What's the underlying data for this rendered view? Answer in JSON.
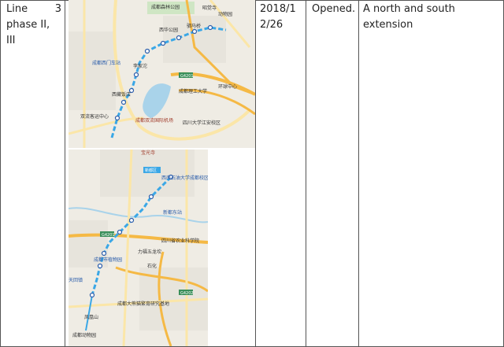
{
  "row": {
    "line_label_a": "Line",
    "line_label_num": "3",
    "line_label_b": "phase II, III",
    "date": "2018/12/26",
    "status": "Opened.",
    "description": "A north and south extension"
  },
  "map_top": {
    "labels": [
      "成都森林公园",
      "西华公园",
      "驷马桥",
      "动物园",
      "中医大学",
      "昭觉寺",
      "成都西门车站",
      "李家沱",
      "双流客运中心",
      "成都双流国际机场",
      "四川大学江安校区",
      "成都理工大学",
      "环球中心",
      "西藏饭店",
      "G4201"
    ]
  },
  "map_bottom": {
    "labels": [
      "宝光寺",
      "新都区",
      "西南石油大学成都校区",
      "新都东站",
      "四川省农业科学院",
      "成都市植物园",
      "力福五龙坎",
      "石化",
      "天回镇",
      "成都大熊猫繁育研究基地",
      "G4201",
      "G4202",
      "成都动物园",
      "凤凰山"
    ]
  },
  "colors": {
    "route": "#3aa7e6",
    "water": "#a9d3ea",
    "road_major": "#f5b945",
    "road_minor": "#fbe6a8",
    "land": "#f3f1ec",
    "park": "#cfe6c4"
  }
}
